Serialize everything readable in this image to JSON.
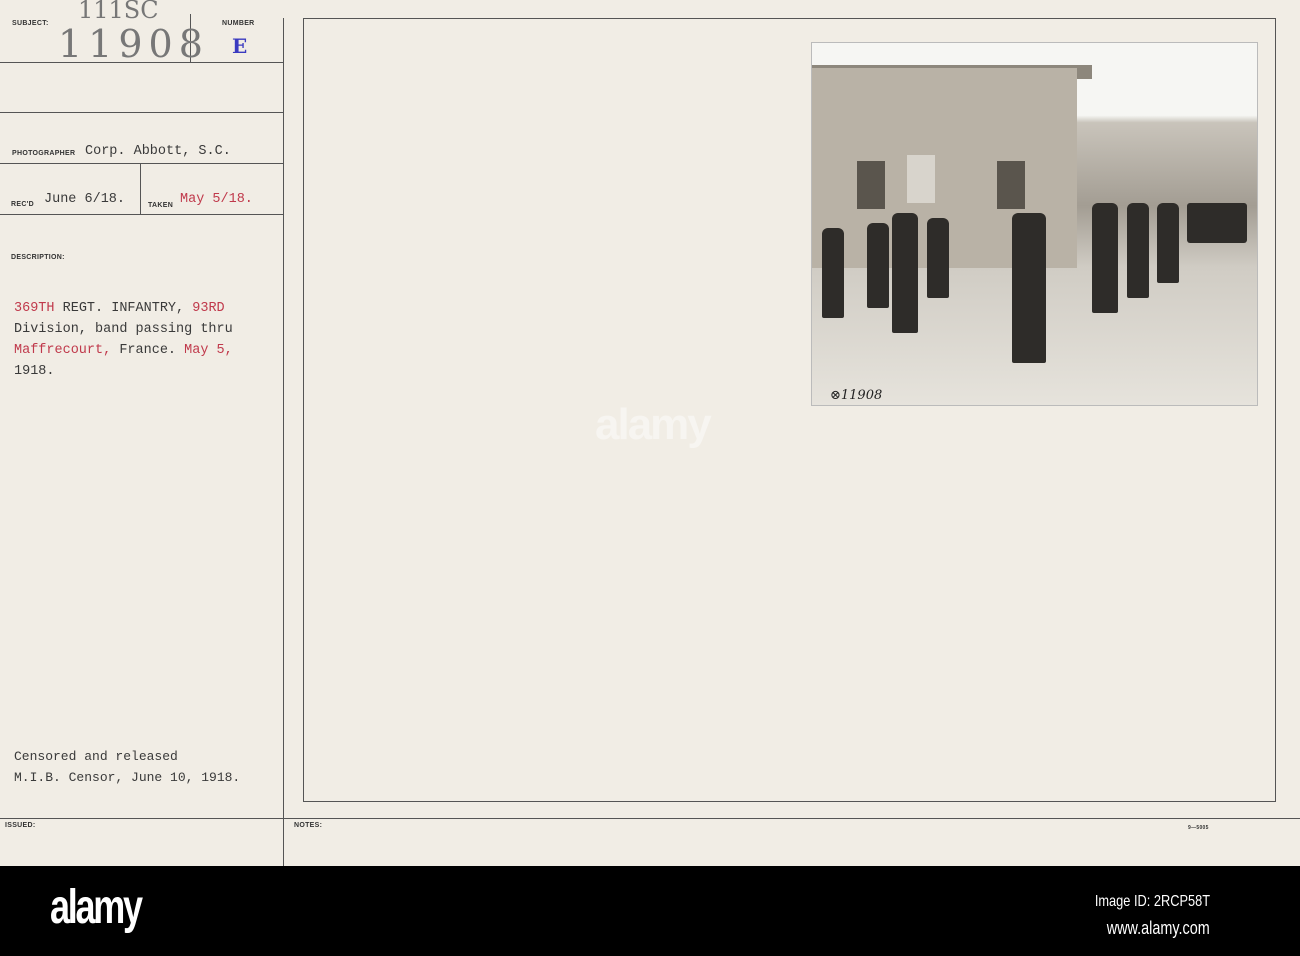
{
  "card": {
    "subject_label": "SUBJECT:",
    "subject_handwritten": "111SC",
    "subject_number_handwritten": "11908",
    "number_label": "NUMBER",
    "number_value": "E",
    "photographer_label": "PHOTOGRAPHER",
    "photographer_value": "Corp. Abbott, S.C.",
    "recd_label": "REC'D",
    "recd_value": "June 6/18.",
    "taken_label": "TAKEN",
    "taken_value": "May 5/18.",
    "description_label": "DESCRIPTION:",
    "description": {
      "l1a": "369TH",
      "l1b": " REGT. INFANTRY, ",
      "l1c": "93RD",
      "l2": "Division, band passing thru",
      "l3a": "Maffrecourt,",
      "l3b": " France. ",
      "l3c": "May 5,",
      "l4": "1918."
    },
    "censor_line1": "Censored and released",
    "censor_line2": "M.I.B. Censor, June 10, 1918.",
    "issued_label": "ISSUED:",
    "notes_label": "NOTES:",
    "form_number": "9—5005",
    "photo_number": "⊗11908"
  },
  "footer": {
    "logo": "alamy",
    "image_id": "Image ID: 2RCP58T",
    "url": "www.alamy.com"
  },
  "watermark": "alamy",
  "colors": {
    "typed_red": "#c0394b",
    "stamp_blue": "#3a3ac0"
  }
}
